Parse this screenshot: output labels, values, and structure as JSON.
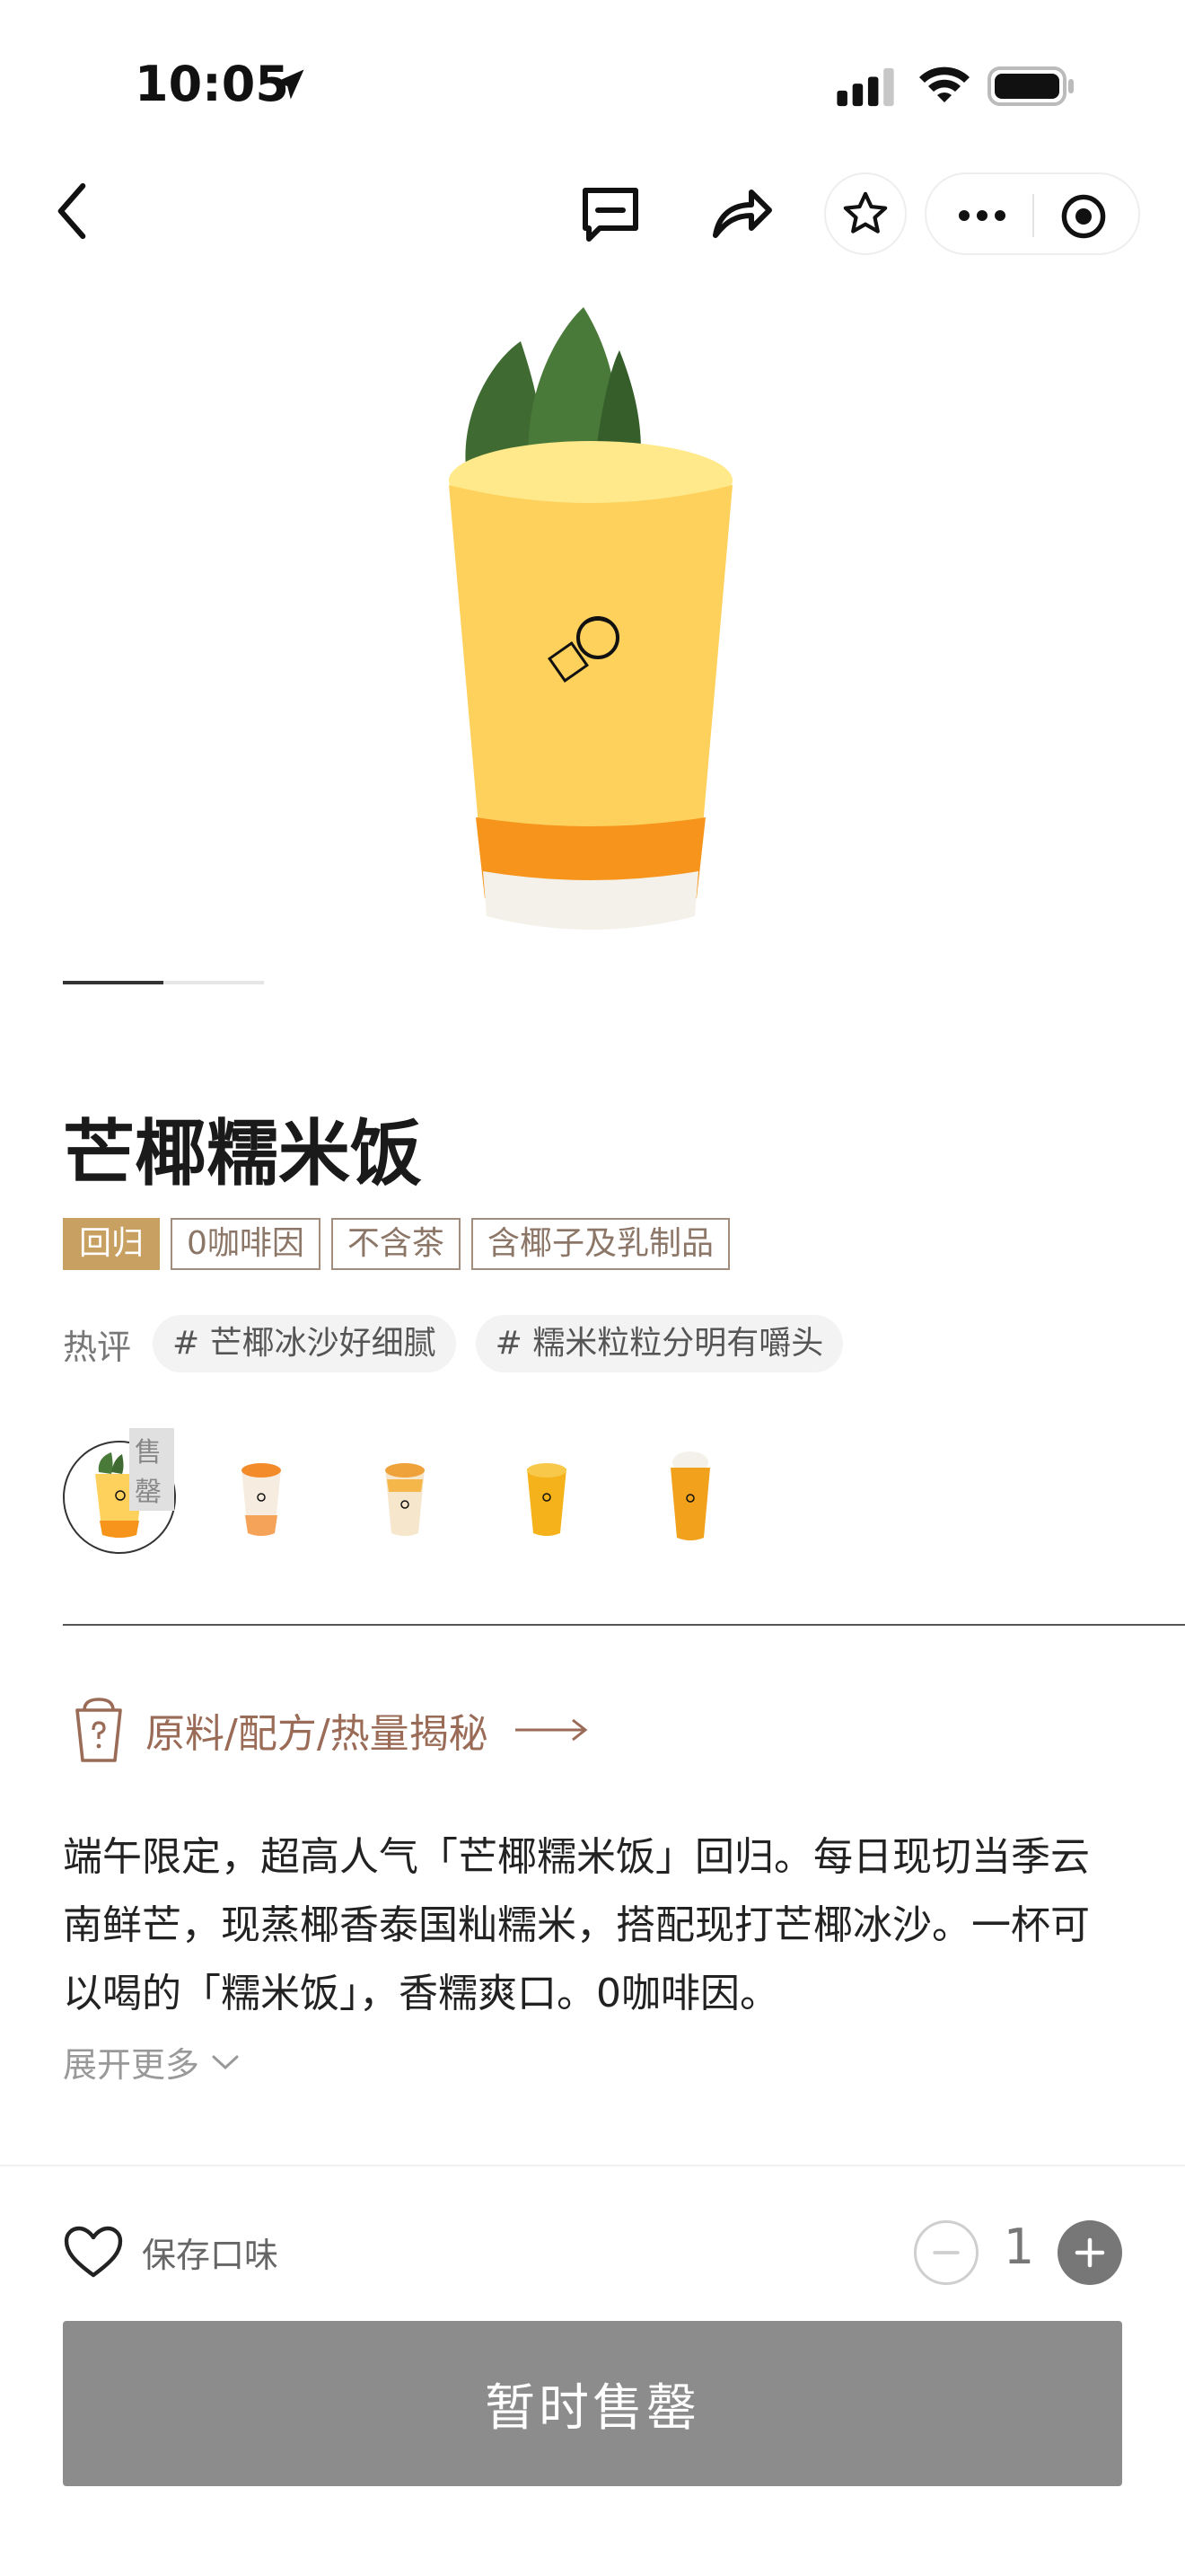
{
  "status_bar": {
    "time": "10:05"
  },
  "product": {
    "title": "芒椰糯米饭",
    "tags": [
      "回归",
      "0咖啡因",
      "不含茶",
      "含椰子及乳制品"
    ],
    "hot_label": "热评",
    "hot_reviews": [
      "# 芒椰冰沙好细腻",
      "# 糯米粒粒分明有嚼头"
    ],
    "sold_out_badge": "售罄",
    "carousel": {
      "current": 1,
      "total": 2
    }
  },
  "recipe": {
    "label": "原料/配方/热量揭秘"
  },
  "description": {
    "text": "端午限定，超高人气「芒椰糯米饭」回归。每日现切当季云南鲜芒，现蒸椰香泰国籼糯米，搭配现打芒椰冰沙。一杯可以喝的「糯米饭」，香糯爽口。0咖啡因。",
    "expand_label": "展开更多"
  },
  "bottom_bar": {
    "save_label": "保存口味",
    "quantity": "1",
    "action_label": "暂时售罄"
  },
  "colors": {
    "accent_tag": "#c8a062",
    "recipe_text": "#9a6b57",
    "disabled_button": "#8c8c8c"
  }
}
